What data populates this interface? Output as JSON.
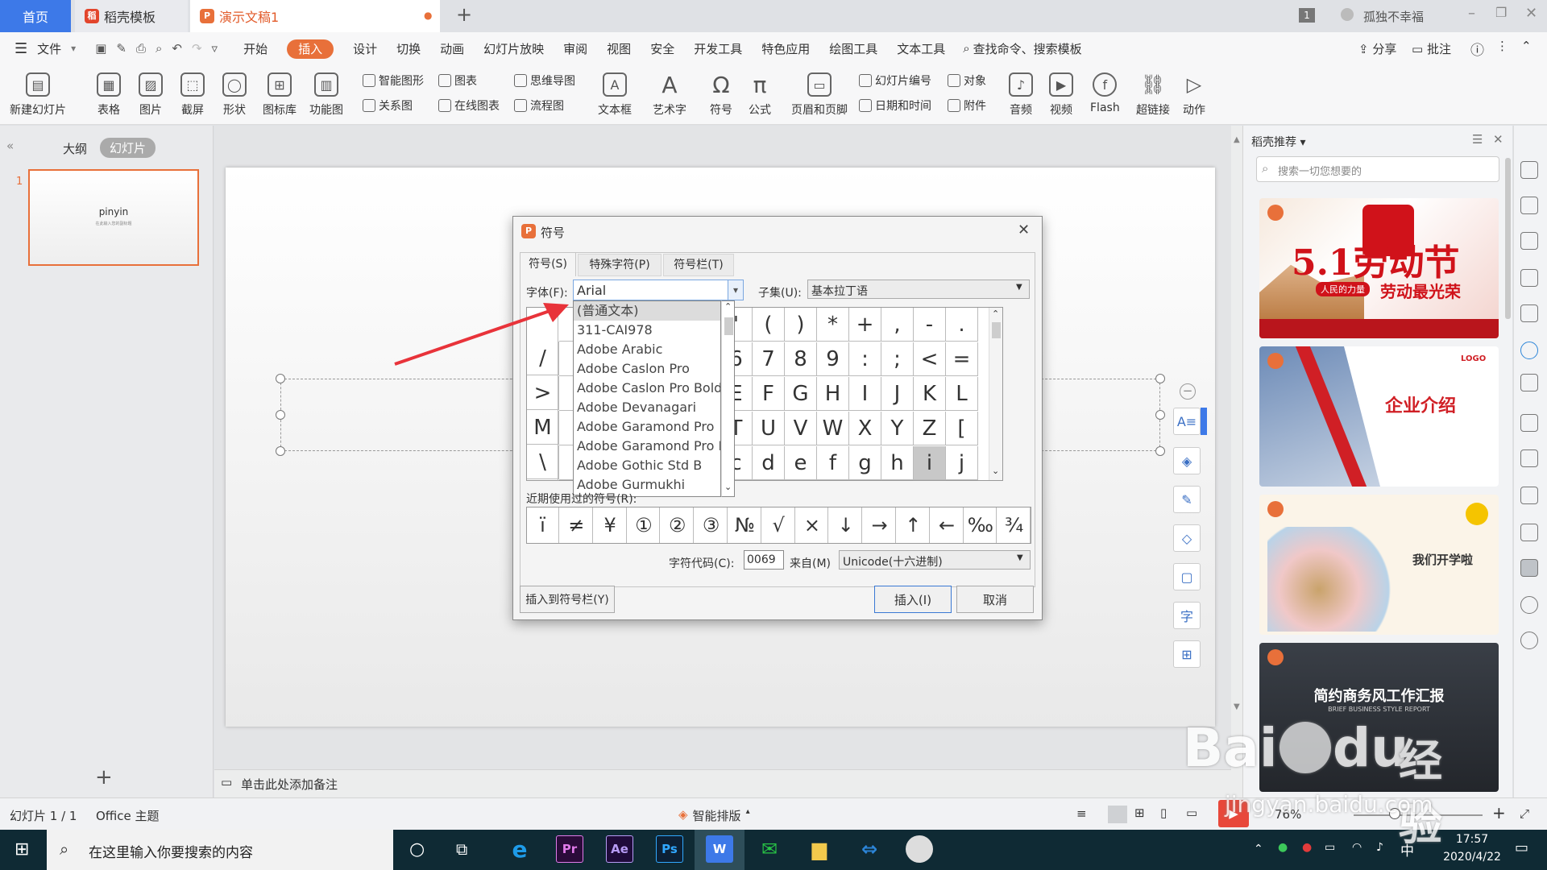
{
  "tabs": {
    "home": "首页",
    "template": "稻壳模板",
    "doc": "演示文稿1",
    "user": "孤独不幸福",
    "badge": "1",
    "add": "+"
  },
  "menu": {
    "file": "文件",
    "items": [
      "开始",
      "插入",
      "设计",
      "切换",
      "动画",
      "幻灯片放映",
      "审阅",
      "视图",
      "安全",
      "开发工具",
      "特色应用",
      "绘图工具",
      "文本工具"
    ],
    "active": "插入",
    "search": "查找命令、搜索模板",
    "share": "分享",
    "comment": "批注"
  },
  "ribbon": {
    "big": [
      "新建幻灯片",
      "表格",
      "图片",
      "截屏",
      "形状",
      "图标库",
      "功能图",
      "文本框",
      "艺术字",
      "符号",
      "公式",
      "页眉和页脚",
      "音频",
      "视频",
      "Flash",
      "超链接",
      "动作"
    ],
    "small": [
      "智能图形",
      "图表",
      "关系图",
      "在线图表",
      "思维导图",
      "流程图",
      "幻灯片编号",
      "对象",
      "日期和时间",
      "附件"
    ]
  },
  "left_panel": {
    "tab_outline": "大纲",
    "tab_slides": "幻灯片",
    "slide_number": "1",
    "thumb_title": "pinyin",
    "thumb_subtitle": "在此输入您的副标题",
    "add": "+"
  },
  "notes": "单击此处添加备注",
  "dialog": {
    "title": "符号",
    "tabs": [
      "符号(S)",
      "特殊字符(P)",
      "符号栏(T)"
    ],
    "font_label": "字体(F):",
    "font_value": "Arial",
    "subset_label": "子集(U):",
    "subset_value": "基本拉丁语",
    "font_list": [
      "(普通文本)",
      "311-CAI978",
      "Adobe Arabic",
      "Adobe Caslon Pro",
      "Adobe Caslon Pro Bold",
      "Adobe Devanagari",
      "Adobe Garamond Pro",
      "Adobe Garamond Pro Bold",
      "Adobe Gothic Std B",
      "Adobe Gurmukhi"
    ],
    "grid_left": [
      "/",
      ">",
      "M",
      "\\"
    ],
    "grid_rows": [
      [
        "'",
        "(",
        ")",
        "*",
        "+",
        ",",
        "-",
        "."
      ],
      [
        "6",
        "7",
        "8",
        "9",
        ":",
        ";",
        "<",
        "="
      ],
      [
        "E",
        "F",
        "G",
        "H",
        "I",
        "J",
        "K",
        "L"
      ],
      [
        "T",
        "U",
        "V",
        "W",
        "X",
        "Y",
        "Z",
        "["
      ],
      [
        "c",
        "d",
        "e",
        "f",
        "g",
        "h",
        "i",
        "j"
      ]
    ],
    "selected_symbol": "i",
    "recent_label": "近期使用过的符号(R):",
    "recent": [
      "ï",
      "≠",
      "¥",
      "①",
      "②",
      "③",
      "№",
      "√",
      "×",
      "↓",
      "→",
      "↑",
      "←",
      "‰",
      "¾"
    ],
    "char_code_label": "字符代码(C):",
    "char_code": "0069",
    "from_label": "来自(M)",
    "from_value": "Unicode(十六进制)",
    "btn_insert_bar": "插入到符号栏(Y)",
    "btn_insert": "插入(I)",
    "btn_cancel": "取消"
  },
  "right_panel": {
    "title": "稻壳推荐",
    "search_placeholder": "搜索一切您想要的",
    "templates": [
      {
        "title": "5.1劳动节",
        "subtitle": "劳动最光荣",
        "tag": "人民的力量"
      },
      {
        "title": "企业介绍",
        "logo": "LOGO"
      },
      {
        "title": "我们开学啦"
      },
      {
        "title": "简约商务风工作汇报",
        "subtitle": "BRIEF BUSINESS STYLE REPORT"
      }
    ]
  },
  "status": {
    "slide": "幻灯片 1 / 1",
    "theme": "Office 主题",
    "smart": "智能排版",
    "zoom": "76%"
  },
  "taskbar": {
    "search": "在这里输入你要搜索的内容",
    "time": "17:57",
    "date": "2020/4/22",
    "ime": "中"
  },
  "watermark": {
    "brand": "Bai",
    "brand2": "du",
    "cn": "经验",
    "url": "jingyan.baidu.com"
  },
  "colors": {
    "accent": "#e8703a",
    "home_tab": "#3d79e8",
    "arrow": "#e8333a"
  }
}
